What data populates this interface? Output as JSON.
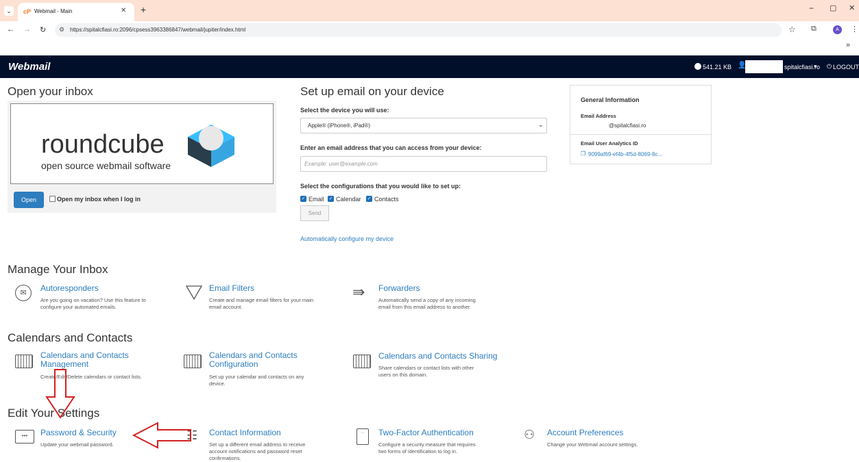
{
  "browser": {
    "tab_title": "Webmail - Main",
    "url": "https://spitalcfiasi.ro:2096/cpsess3963386847/webmail/jupiter/index.html",
    "profile_initial": "A",
    "overflow": "»"
  },
  "header": {
    "logo": "Webmail",
    "disk_usage": "541.21 KB",
    "account_suffix": "spitalcfiasi.ro",
    "logout": "LOGOUT"
  },
  "inbox": {
    "title": "Open your inbox",
    "logo_word": "roundcube",
    "logo_tagline": "open source webmail software",
    "open_button": "Open",
    "open_on_login": "Open my inbox when I log in"
  },
  "device": {
    "title": "Set up email on your device",
    "select_label": "Select the device you will use:",
    "device_value": "Apple® (iPhone®, iPad®)",
    "email_label": "Enter an email address that you can access from your device:",
    "email_placeholder": "Example: user@example.com",
    "config_label": "Select the configurations that you would like to set up:",
    "opt_email": "Email",
    "opt_calendar": "Calendar",
    "opt_contacts": "Contacts",
    "send": "Send",
    "auto_link": "Automatically configure my device"
  },
  "general": {
    "title": "General Information",
    "email_label": "Email Address",
    "email_value": "@spitalcfiasi.ro",
    "analytics_label": "Email User Analytics ID",
    "analytics_value": "9099af69-ef4b-4f5d-8069-8c..."
  },
  "manage": {
    "title": "Manage Your Inbox",
    "items": [
      {
        "title": "Autoresponders",
        "desc1": "Are you going on vacation? Use this feature to",
        "desc2": "configure your automated emails."
      },
      {
        "title": "Email Filters",
        "desc1": "Create and manage email filters for your main",
        "desc2": "email account."
      },
      {
        "title": "Forwarders",
        "desc1": "Automatically send a copy of any incoming",
        "desc2": "email from this email address to another."
      }
    ]
  },
  "calendars": {
    "title": "Calendars and Contacts",
    "items": [
      {
        "title1": "Calendars and Contacts",
        "title2": "Management",
        "desc1": "Create/Edit/Delete calendars or contact lists.",
        "desc2": ""
      },
      {
        "title1": "Calendars and Contacts",
        "title2": "Configuration",
        "desc1": "Set up your calendar and contacts on any",
        "desc2": "device."
      },
      {
        "title1": "Calendars and Contacts Sharing",
        "title2": "",
        "desc1": "Share calendars or contact lists with other",
        "desc2": "users on this domain."
      }
    ]
  },
  "settings": {
    "title": "Edit Your Settings",
    "items": [
      {
        "title": "Password & Security",
        "desc1": "Update your webmail password.",
        "desc2": "",
        "desc3": ""
      },
      {
        "title": "Contact Information",
        "desc1": "Set up a different email address to receive",
        "desc2": "account notifications and password reset",
        "desc3": "confirmations."
      },
      {
        "title": "Two-Factor Authentication",
        "desc1": "Configure a security measure that requires",
        "desc2": "two forms of identification to log in.",
        "desc3": ""
      },
      {
        "title": "Account Preferences",
        "desc1": "Change your Webmail account settings.",
        "desc2": "",
        "desc3": ""
      }
    ]
  },
  "colors": {
    "accent": "#2d7dbf",
    "header_bg": "#020f2b",
    "annotation": "#d42020"
  }
}
